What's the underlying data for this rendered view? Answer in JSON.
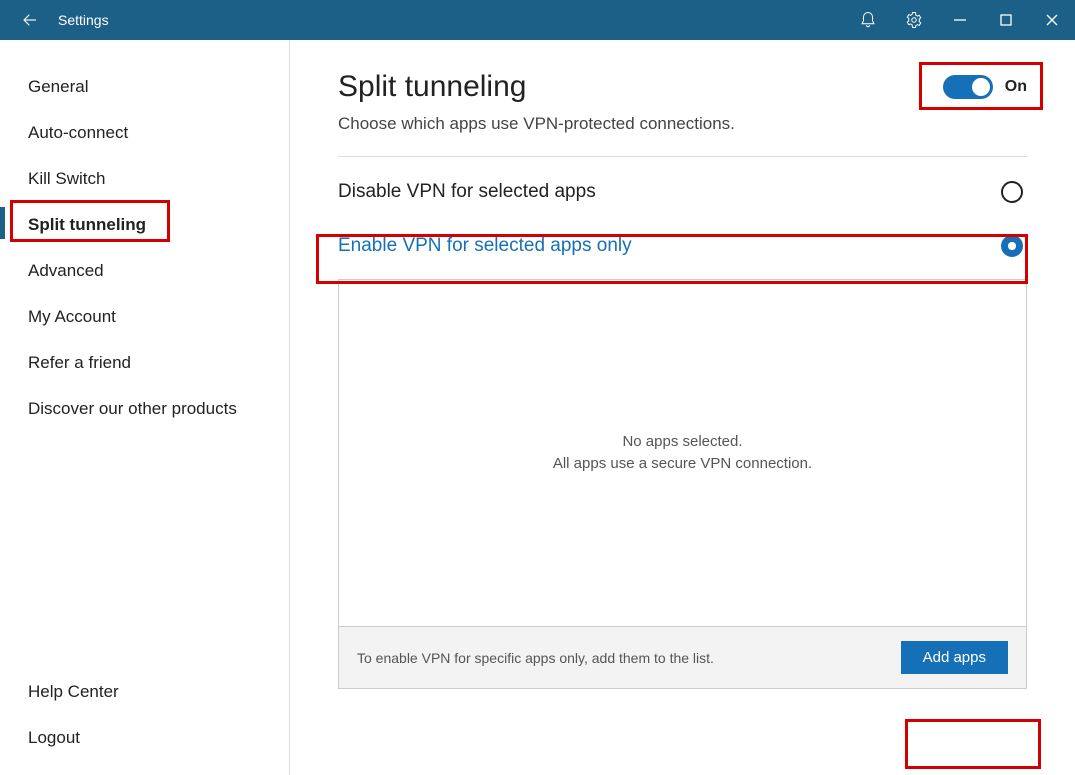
{
  "titlebar": {
    "title": "Settings"
  },
  "sidebar": {
    "items": [
      "General",
      "Auto-connect",
      "Kill Switch",
      "Split tunneling",
      "Advanced",
      "My Account",
      "Refer a friend",
      "Discover our other products"
    ],
    "selected_index": 3,
    "footer": [
      "Help Center",
      "Logout"
    ]
  },
  "main": {
    "title": "Split tunneling",
    "subtitle": "Choose which apps use VPN-protected connections.",
    "toggle_label": "On",
    "toggle_on": true,
    "options": [
      {
        "label": "Disable VPN for selected apps",
        "selected": false
      },
      {
        "label": "Enable VPN for selected apps only",
        "selected": true
      }
    ],
    "empty_line1": "No apps selected.",
    "empty_line2": "All apps use a secure VPN connection.",
    "footer_hint": "To enable VPN for specific apps only, add them to the list.",
    "add_button": "Add apps"
  },
  "colors": {
    "titlebar": "#1c5f87",
    "accent": "#1670b8",
    "highlight": "#d40000"
  }
}
